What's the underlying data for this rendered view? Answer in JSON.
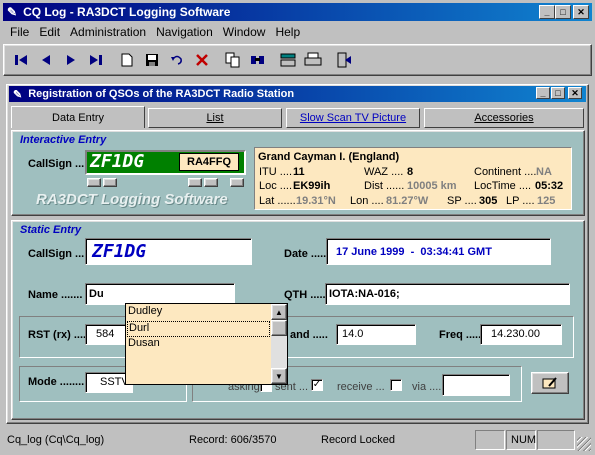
{
  "app": {
    "title": "CQ Log - RA3DCT Logging Software"
  },
  "menu": [
    "File",
    "Edit",
    "Administration",
    "Navigation",
    "Window",
    "Help"
  ],
  "toolbar": [
    "first-icon",
    "prev-icon",
    "next-icon",
    "last-icon",
    "new-icon",
    "save-icon",
    "undo-icon",
    "delete-icon",
    "copy-icon",
    "find-icon",
    "export-icon",
    "print-icon",
    "exit-icon"
  ],
  "child": {
    "title": "Registration of QSOs of the RA3DCT Radio Station"
  },
  "tabs": [
    "Data Entry",
    "List",
    "Slow Scan TV Picture",
    "Accessories"
  ],
  "interactive": {
    "title": "Interactive Entry",
    "callsign_label": "CallSign ....",
    "callsign": "ZF1DG",
    "my_call": "RA4FFQ",
    "watermark": "RA3DCT Logging Software"
  },
  "info": {
    "country": "Grand Cayman I. (England)",
    "itu_label": "ITU ....",
    "itu": "11",
    "waz_label": "WAZ ....",
    "waz": "8",
    "continent_label": "Continent ....",
    "continent": "NA",
    "loc_label": "Loc ....",
    "loc": "EK99ih",
    "dist_label": "Dist ......",
    "dist": "10005 km",
    "loctime_label": "LocTime ....",
    "loctime": "05:32",
    "lat_label": "Lat ......",
    "lat": "19.31°N",
    "lon_label": "Lon ....",
    "lon": "81.27°W",
    "sp_label": "SP ....",
    "sp": "305",
    "lp_label": "LP ....",
    "lp": "125"
  },
  "static": {
    "title": "Static Entry",
    "callsign_label": "CallSign ....",
    "callsign": "ZF1DG",
    "date_label": "Date .....",
    "date": "17 June 1999  -  03:34:41 GMT",
    "name_label": "Name .......",
    "name": "Du",
    "qth_label": "QTH .......",
    "qth": "IOTA:NA-016;",
    "rst_label": "RST (rx) ....",
    "rst": "584",
    "band_label": "and .....",
    "band": "14.0",
    "freq_label": "Freq .....",
    "freq": "14.230.00",
    "mode_label": "Mode ........",
    "mode": "SSTV",
    "asking_label": "asking ...",
    "sent_label": "sent ...",
    "receive_label": "receive ...",
    "via_label": "via ......",
    "via": ""
  },
  "dropdown": [
    "Dudley",
    "Durl",
    "Dusan"
  ],
  "status": {
    "left": "Cq_log (Cq\\Cq_log)",
    "record": "Record: 606/3570",
    "locked": "Record Locked",
    "num": "NUM"
  }
}
